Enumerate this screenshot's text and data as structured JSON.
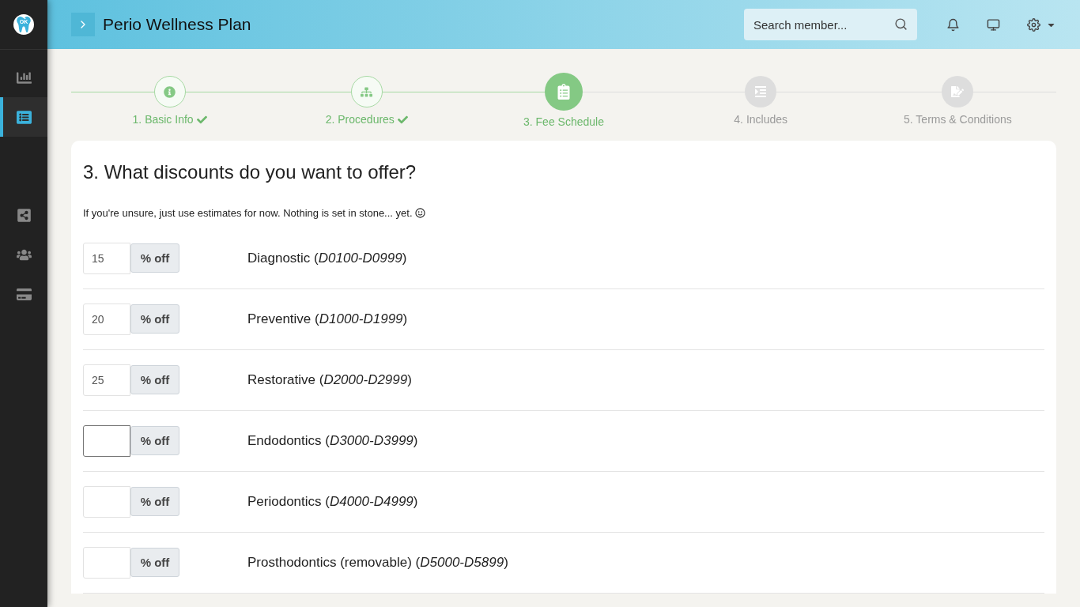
{
  "sidebar": {
    "logo_text": "OK",
    "top_items": [
      {
        "selected": false
      },
      {
        "selected": true
      }
    ],
    "bottom_items": [
      {
        "selected": false
      },
      {
        "selected": false
      },
      {
        "selected": false
      }
    ]
  },
  "header": {
    "title": "Perio Wellness Plan",
    "search": {
      "placeholder": "Search member..."
    }
  },
  "steps": [
    {
      "label": "1. Basic Info",
      "completed": true,
      "selected": false
    },
    {
      "label": "2. Procedures",
      "completed": true,
      "selected": false
    },
    {
      "label": "3. Fee Schedule",
      "completed": false,
      "selected": true
    },
    {
      "label": "4. Includes",
      "completed": false,
      "selected": false
    },
    {
      "label": "5. Terms & Conditions",
      "completed": false,
      "selected": false
    }
  ],
  "form": {
    "title": "3. What discounts do you want to offer?",
    "hint": "If you're unsure, just use estimates for now. Nothing is set in stone... yet.",
    "rows": [
      {
        "value": "15",
        "unit": "% off",
        "label": "Diagnostic (*D0100-D0999*)",
        "focused": false
      },
      {
        "value": "20",
        "unit": "% off",
        "label": "Preventive (*D1000-D1999*)",
        "focused": false
      },
      {
        "value": "25",
        "unit": "% off",
        "label": "Restorative (*D2000-D2999*)",
        "focused": false
      },
      {
        "unit": "% off",
        "label": "Endodontics (*D3000-D3999*)",
        "focused": true
      },
      {
        "unit": "% off",
        "label": "Periodontics (*D4000-D4999*)",
        "focused": false
      },
      {
        "unit": "% off",
        "label": "Prosthodontics (removable) (*D5000-D5899*)",
        "focused": false
      }
    ]
  }
}
